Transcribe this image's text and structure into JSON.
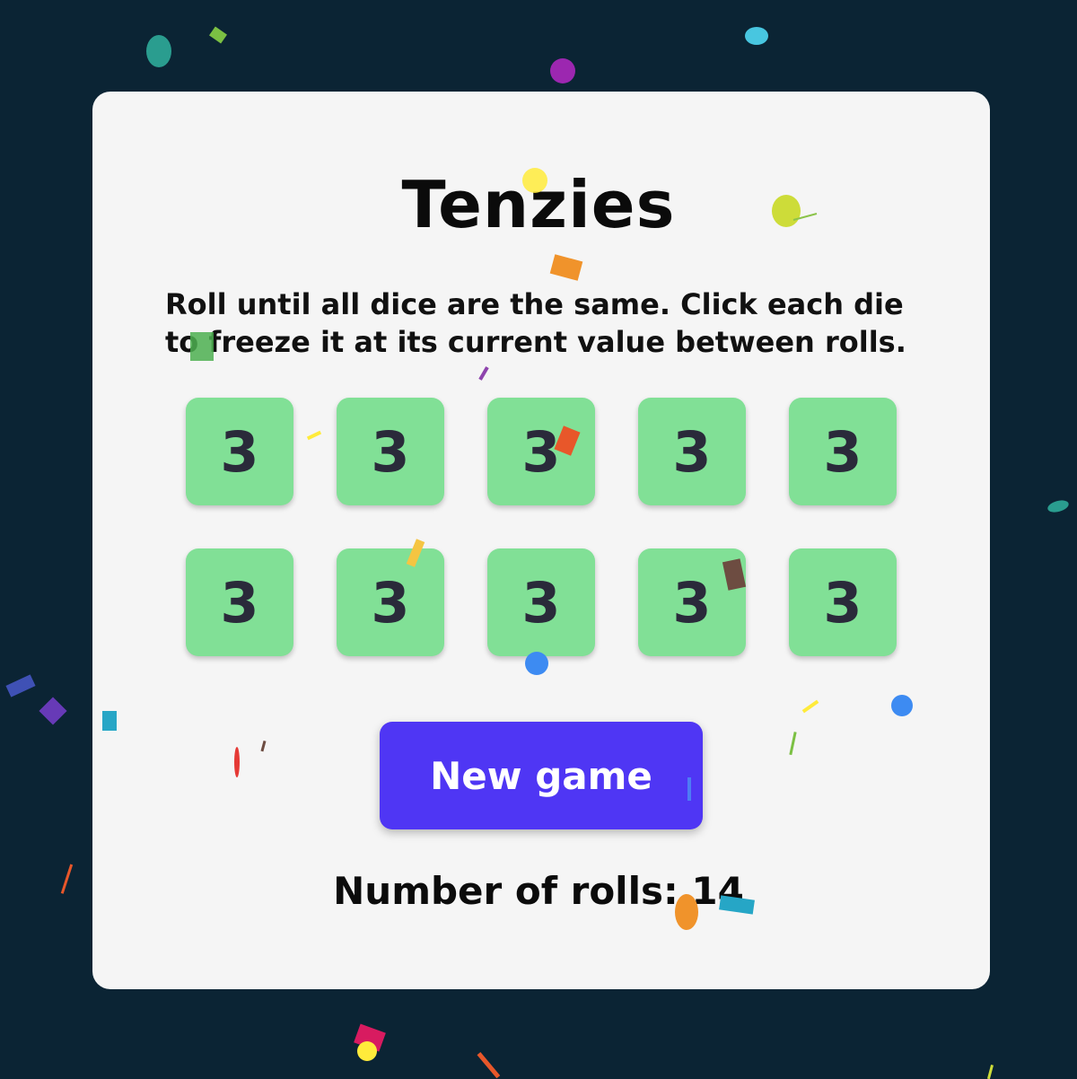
{
  "game": {
    "title": "Tenzies",
    "instructions": "Roll until all dice are the same. Click each die to freeze it at its current value between rolls.",
    "dice": [
      3,
      3,
      3,
      3,
      3,
      3,
      3,
      3,
      3,
      3
    ],
    "new_game_label": "New game",
    "rolls_label": "Number of rolls: 14"
  },
  "colors": {
    "background": "#0b2434",
    "panel": "#f5f5f5",
    "die_held": "#81e096",
    "button": "#4f36f4"
  }
}
